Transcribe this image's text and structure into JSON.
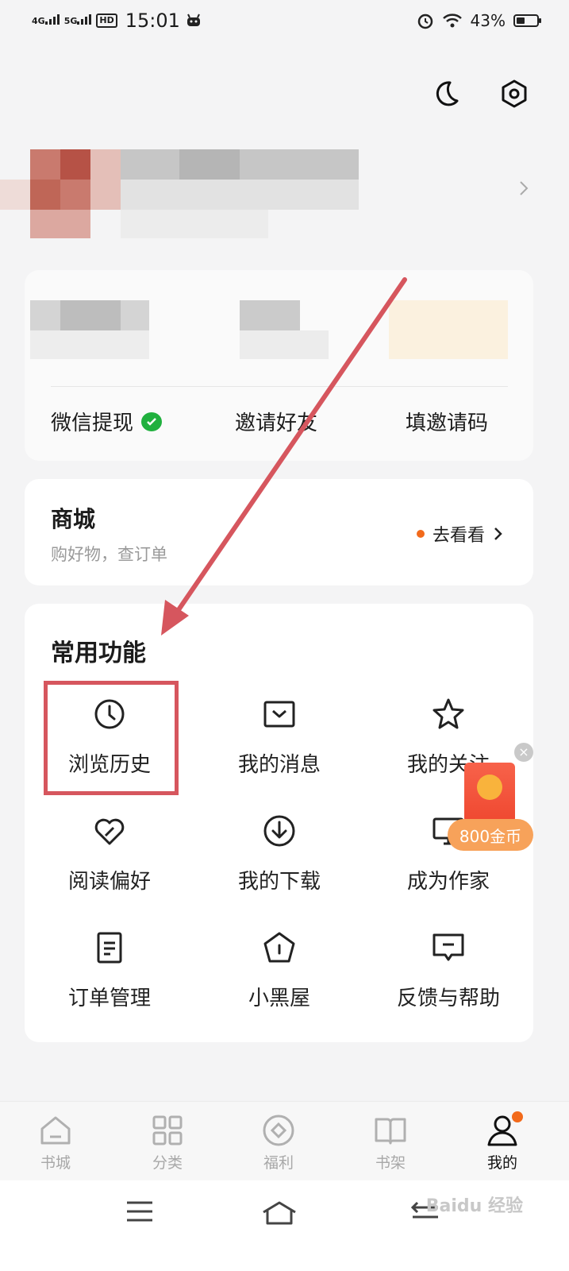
{
  "status_bar": {
    "net1": "4G",
    "net2": "5G",
    "hd": "HD",
    "time": "15:01",
    "battery": "43%",
    "battery_level": 0.43
  },
  "header": {
    "dark_mode_icon": "moon-icon",
    "settings_icon": "hexagon-settings-icon"
  },
  "account_links": [
    {
      "label": "微信提现",
      "icon": "wechat-check-icon"
    },
    {
      "label": "邀请好友"
    },
    {
      "label": "填邀请码"
    }
  ],
  "mall": {
    "title": "商城",
    "subtitle": "购好物，查订单",
    "action": "去看看"
  },
  "common_functions": {
    "title": "常用功能",
    "items": [
      {
        "label": "浏览历史",
        "icon": "clock-icon"
      },
      {
        "label": "我的消息",
        "icon": "message-box-icon"
      },
      {
        "label": "我的关注",
        "icon": "star-icon"
      },
      {
        "label": "阅读偏好",
        "icon": "heart-icon"
      },
      {
        "label": "我的下载",
        "icon": "download-icon"
      },
      {
        "label": "成为作家",
        "icon": "monitor-icon"
      },
      {
        "label": "订单管理",
        "icon": "document-icon"
      },
      {
        "label": "小黑屋",
        "icon": "house-icon"
      },
      {
        "label": "反馈与帮助",
        "icon": "feedback-icon"
      }
    ]
  },
  "promo": {
    "coins": "800金币"
  },
  "bottom_nav": [
    {
      "label": "书城",
      "icon": "home-icon"
    },
    {
      "label": "分类",
      "icon": "grid-icon"
    },
    {
      "label": "福利",
      "icon": "welfare-icon"
    },
    {
      "label": "书架",
      "icon": "book-icon"
    },
    {
      "label": "我的",
      "icon": "person-icon",
      "active": true
    }
  ],
  "watermark": "Baidu 经验",
  "colors": {
    "accent": "#f26a1b",
    "annotation": "#d6565e",
    "wechat": "#20b03e"
  }
}
